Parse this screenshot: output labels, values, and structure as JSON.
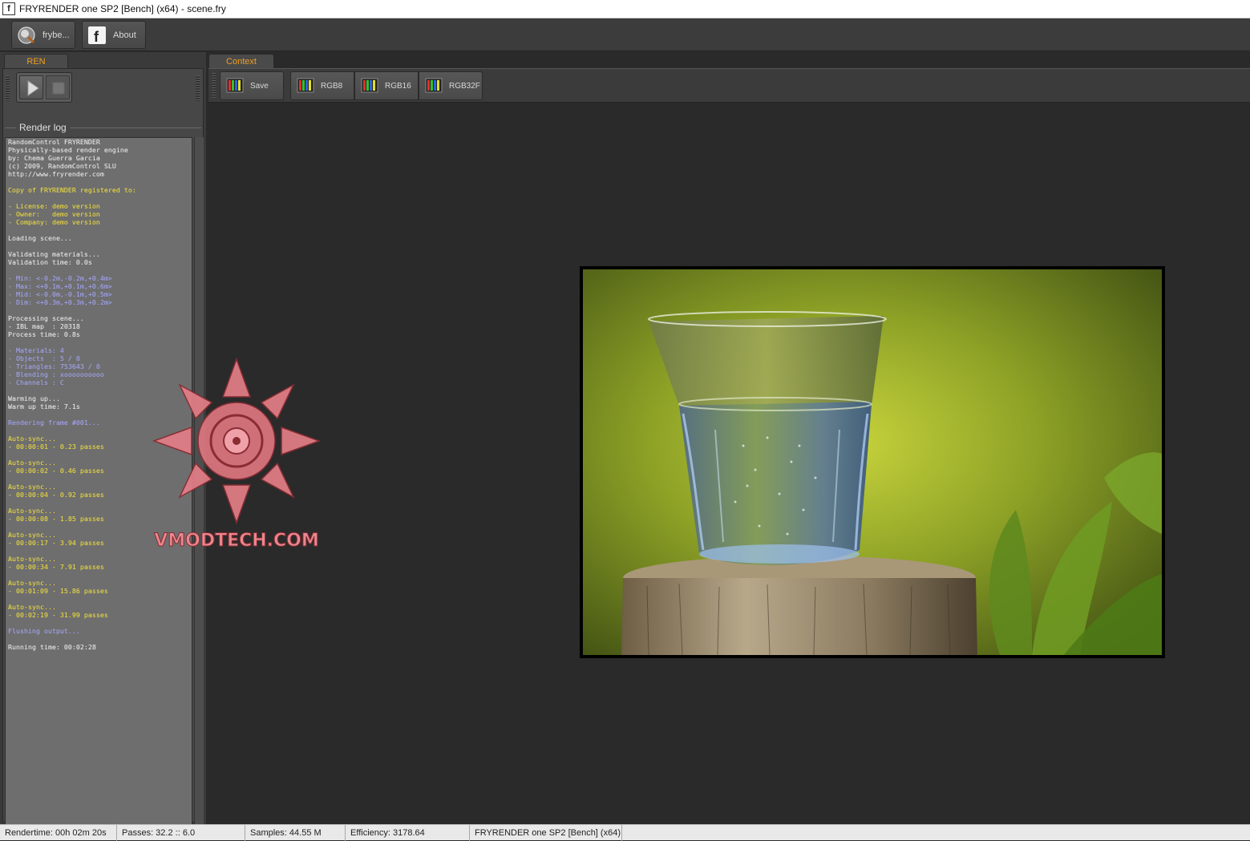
{
  "window": {
    "title": "FRYRENDER one SP2 [Bench] (x64) - scene.fry",
    "app_icon_glyph": "f"
  },
  "toolbar": {
    "buttons": [
      {
        "label": "frybe...",
        "icon": "frybench-logo-icon"
      },
      {
        "label": "About",
        "icon": "facebook-icon"
      }
    ]
  },
  "left_panel": {
    "tab_label": "REN",
    "group_label": "Render log",
    "log_lines": [
      {
        "text": "RandomControl FRYRENDER",
        "color": "white"
      },
      {
        "text": "Physically-based render engine",
        "color": "white"
      },
      {
        "text": "by: Chema Guerra Garcia",
        "color": "white"
      },
      {
        "text": "(c) 2009, RandomControl SLU",
        "color": "white"
      },
      {
        "text": "http://www.fryrender.com",
        "color": "white"
      },
      {
        "text": "",
        "color": "white"
      },
      {
        "text": "Copy of FRYRENDER registered to:",
        "color": "yellow"
      },
      {
        "text": "",
        "color": "white"
      },
      {
        "text": "- License: demo version",
        "color": "yellow"
      },
      {
        "text": "- Owner:   demo version",
        "color": "yellow"
      },
      {
        "text": "- Company: demo version",
        "color": "yellow"
      },
      {
        "text": "",
        "color": "white"
      },
      {
        "text": "Loading scene...",
        "color": "white"
      },
      {
        "text": "",
        "color": "white"
      },
      {
        "text": "Validating materials...",
        "color": "white"
      },
      {
        "text": "Validation time: 0.0s",
        "color": "white"
      },
      {
        "text": "",
        "color": "white"
      },
      {
        "text": "- Min: <-0.2m,-0.2m,+0.4m>",
        "color": "blue"
      },
      {
        "text": "- Max: <+0.1m,+0.1m,+0.6m>",
        "color": "blue"
      },
      {
        "text": "- Mid: <-0.0m,-0.1m,+0.5m>",
        "color": "blue"
      },
      {
        "text": "- Dim: <+0.3m,+0.3m,+0.2m>",
        "color": "blue"
      },
      {
        "text": "",
        "color": "white"
      },
      {
        "text": "Processing scene...",
        "color": "white"
      },
      {
        "text": "- IBL map  : 20318",
        "color": "white"
      },
      {
        "text": "Process time: 0.8s",
        "color": "white"
      },
      {
        "text": "",
        "color": "white"
      },
      {
        "text": "- Materials: 4",
        "color": "blue"
      },
      {
        "text": "- Objects  : 5 / 0",
        "color": "blue"
      },
      {
        "text": "- Triangles: 753643 / 0",
        "color": "blue"
      },
      {
        "text": "- Blending : xoooooooooo",
        "color": "blue"
      },
      {
        "text": "- Channels : C",
        "color": "blue"
      },
      {
        "text": "",
        "color": "white"
      },
      {
        "text": "Warming up...",
        "color": "white"
      },
      {
        "text": "Warm up time: 7.1s",
        "color": "white"
      },
      {
        "text": "",
        "color": "white"
      },
      {
        "text": "Rendering frame #001...",
        "color": "blue"
      },
      {
        "text": "",
        "color": "white"
      },
      {
        "text": "Auto-sync...",
        "color": "yellow"
      },
      {
        "text": "- 00:00:01 - 0.23 passes",
        "color": "yellow"
      },
      {
        "text": "",
        "color": "white"
      },
      {
        "text": "Auto-sync...",
        "color": "yellow"
      },
      {
        "text": "- 00:00:02 - 0.46 passes",
        "color": "yellow"
      },
      {
        "text": "",
        "color": "white"
      },
      {
        "text": "Auto-sync...",
        "color": "yellow"
      },
      {
        "text": "- 00:00:04 - 0.92 passes",
        "color": "yellow"
      },
      {
        "text": "",
        "color": "white"
      },
      {
        "text": "Auto-sync...",
        "color": "yellow"
      },
      {
        "text": "- 00:00:08 - 1.85 passes",
        "color": "yellow"
      },
      {
        "text": "",
        "color": "white"
      },
      {
        "text": "Auto-sync...",
        "color": "yellow"
      },
      {
        "text": "- 00:00:17 - 3.94 passes",
        "color": "yellow"
      },
      {
        "text": "",
        "color": "white"
      },
      {
        "text": "Auto-sync...",
        "color": "yellow"
      },
      {
        "text": "- 00:00:34 - 7.91 passes",
        "color": "yellow"
      },
      {
        "text": "",
        "color": "white"
      },
      {
        "text": "Auto-sync...",
        "color": "yellow"
      },
      {
        "text": "- 00:01:09 - 15.86 passes",
        "color": "yellow"
      },
      {
        "text": "",
        "color": "white"
      },
      {
        "text": "Auto-sync...",
        "color": "yellow"
      },
      {
        "text": "- 00:02:19 - 31.99 passes",
        "color": "yellow"
      },
      {
        "text": "",
        "color": "white"
      },
      {
        "text": "Flushing output...",
        "color": "blue"
      },
      {
        "text": "",
        "color": "white"
      },
      {
        "text": "Running time: 00:02:28",
        "color": "white"
      }
    ]
  },
  "right_panel": {
    "tab_label": "Context",
    "buttons": [
      {
        "label": "Save",
        "icon": "rgb-bars-icon"
      },
      {
        "label": "RGB8",
        "icon": "rgb-bars-icon"
      },
      {
        "label": "RGB16",
        "icon": "rgb-bars-icon"
      },
      {
        "label": "RGB32F",
        "icon": "rgb-bars-icon"
      }
    ]
  },
  "watermark": {
    "text": "VMODTECH.COM"
  },
  "statusbar": {
    "rendertime": "Rendertime:  00h 02m 20s",
    "passes": "Passes:  32.2 :: 6.0",
    "samples": "Samples:  44.55 M",
    "efficiency": "Efficiency:  3178.64",
    "product": "FRYRENDER one SP2 [Bench] (x64)"
  },
  "colors": {
    "accent_tab": "#f0a020",
    "log_white": "#f4f4f4",
    "log_yellow": "#f5e23a",
    "log_blue": "#a7a8ff"
  }
}
